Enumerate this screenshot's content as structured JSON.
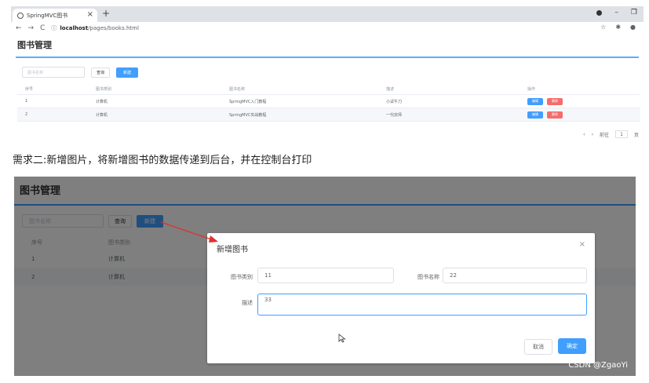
{
  "browser": {
    "tab_title": "SpringMVC图书",
    "tab_close": "×",
    "new_tab": "+",
    "url_host": "localhost",
    "url_path": "/pages/books.html",
    "win_min": "–",
    "win_restore": "❐"
  },
  "app": {
    "title": "图书管理",
    "search_placeholder": "图书名称",
    "query_label": "查询",
    "new_label": "新建",
    "columns": [
      "序号",
      "图书类别",
      "图书名称",
      "描述",
      "操作"
    ],
    "rows": [
      {
        "index": "1",
        "type": "计算机",
        "name": "SpringMVC入门教程",
        "description": "小试牛刀"
      },
      {
        "index": "2",
        "type": "计算机",
        "name": "SpringMVC实战教程",
        "description": "一代宗师"
      }
    ],
    "edit_label": "编辑",
    "delete_label": "删除",
    "pager": {
      "prev": "‹",
      "next": "›",
      "goto_label": "前往",
      "page": "1",
      "page_unit": "页"
    }
  },
  "caption": "需求二:新增图片，将新增图书的数据传递到后台，并在控制台打印",
  "dialog": {
    "title": "新增图书",
    "close": "×",
    "type_label": "图书类别",
    "type_value": "11",
    "name_label": "图书名称",
    "name_value": "22",
    "desc_label": "描述",
    "desc_value": "33",
    "cancel_label": "取消",
    "confirm_label": "确定"
  },
  "watermark": "CSDN @ZgaoYi",
  "colors": {
    "primary": "#409eff",
    "danger": "#f56c6c",
    "arrow": "#e03030"
  }
}
